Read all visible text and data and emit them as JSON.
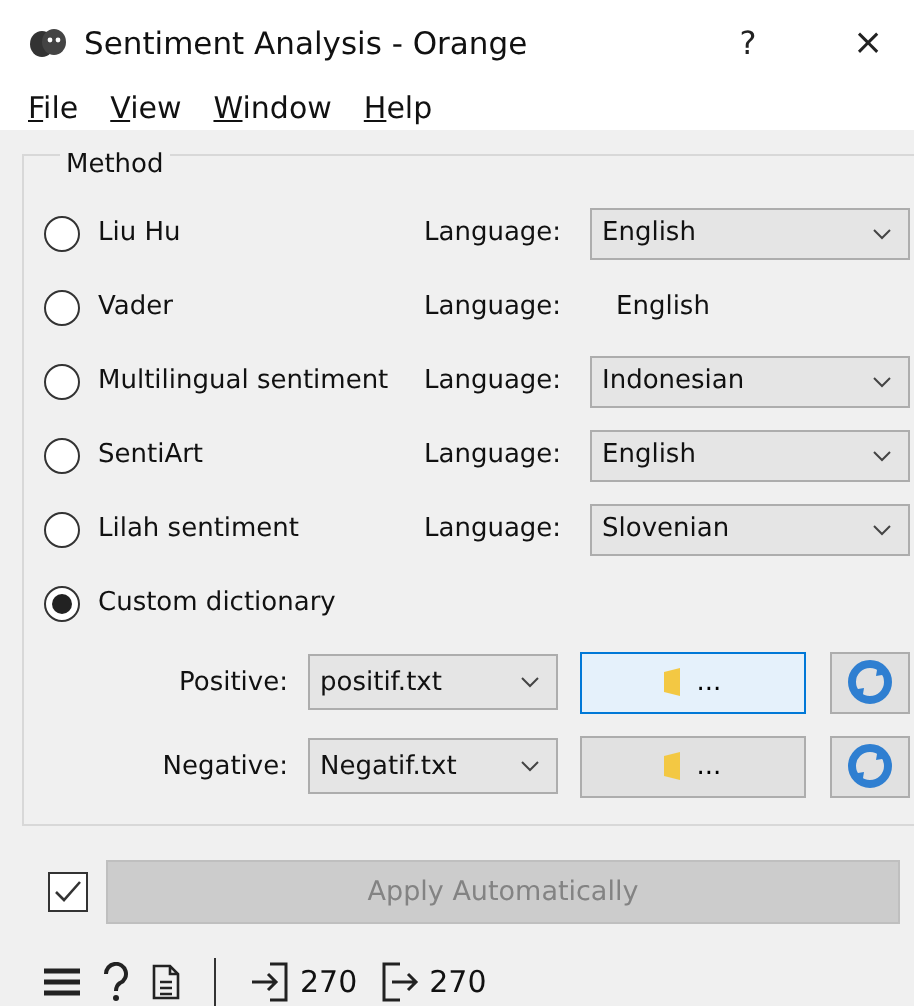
{
  "window": {
    "title": "Sentiment Analysis - Orange",
    "help": "?",
    "close": "×"
  },
  "menu": [
    "File",
    "View",
    "Window",
    "Help"
  ],
  "method": {
    "title": "Method",
    "options": [
      {
        "label": "Liu Hu",
        "selected": false,
        "language_label": "Language:",
        "language": "English",
        "kind": "combo"
      },
      {
        "label": "Vader",
        "selected": false,
        "language_label": "Language:",
        "language": "English",
        "kind": "fixed"
      },
      {
        "label": "Multilingual sentiment",
        "selected": false,
        "language_label": "Language:",
        "language": "Indonesian",
        "kind": "combo"
      },
      {
        "label": "SentiArt",
        "selected": false,
        "language_label": "Language:",
        "language": "English",
        "kind": "combo"
      },
      {
        "label": "Lilah sentiment",
        "selected": false,
        "language_label": "Language:",
        "language": "Slovenian",
        "kind": "combo"
      },
      {
        "label": "Custom dictionary",
        "selected": true,
        "kind": "none"
      }
    ],
    "dictionaries": [
      {
        "label": "Positive:",
        "file": "positif.txt",
        "browse": "...",
        "focused": true
      },
      {
        "label": "Negative:",
        "file": "Negatif.txt",
        "browse": "...",
        "focused": false
      }
    ]
  },
  "apply": {
    "checked": true,
    "label": "Apply Automatically",
    "disabled": true
  },
  "status": {
    "input": "270",
    "output": "270"
  }
}
